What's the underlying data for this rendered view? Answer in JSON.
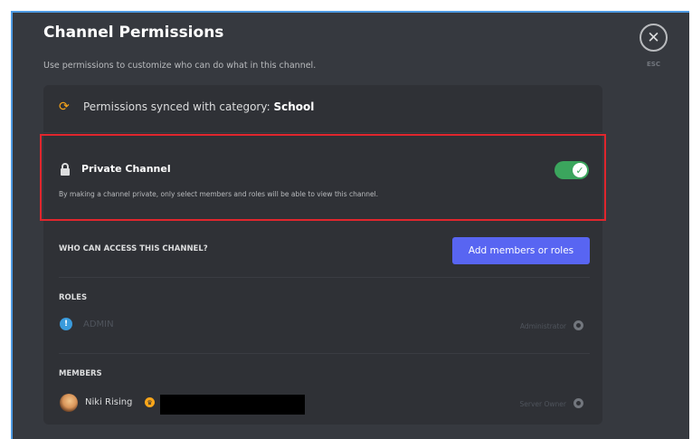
{
  "modal": {
    "title": "Channel Permissions",
    "subtitle": "Use permissions to customize who can do what in this channel.",
    "close_label": "ESC"
  },
  "sync": {
    "text_prefix": "Permissions synced with category: ",
    "category": "School",
    "icon": "sync-icon"
  },
  "private_channel": {
    "title": "Private Channel",
    "description": "By making a channel private, only select members and roles will be able to view this channel.",
    "enabled": true,
    "toggle_color": "#3ba55d"
  },
  "access": {
    "label": "WHO CAN ACCESS THIS CHANNEL?",
    "add_button": "Add members or roles",
    "add_button_color": "#5865f2"
  },
  "roles": {
    "label": "ROLES",
    "items": [
      {
        "name": "ADMIN",
        "tag": "Administrator"
      }
    ]
  },
  "members": {
    "label": "MEMBERS",
    "items": [
      {
        "name": "Niki Rising",
        "tag": "Server Owner"
      }
    ]
  },
  "colors": {
    "background": "#36393f",
    "panel": "#2f3136",
    "highlight": "#e0262d"
  }
}
